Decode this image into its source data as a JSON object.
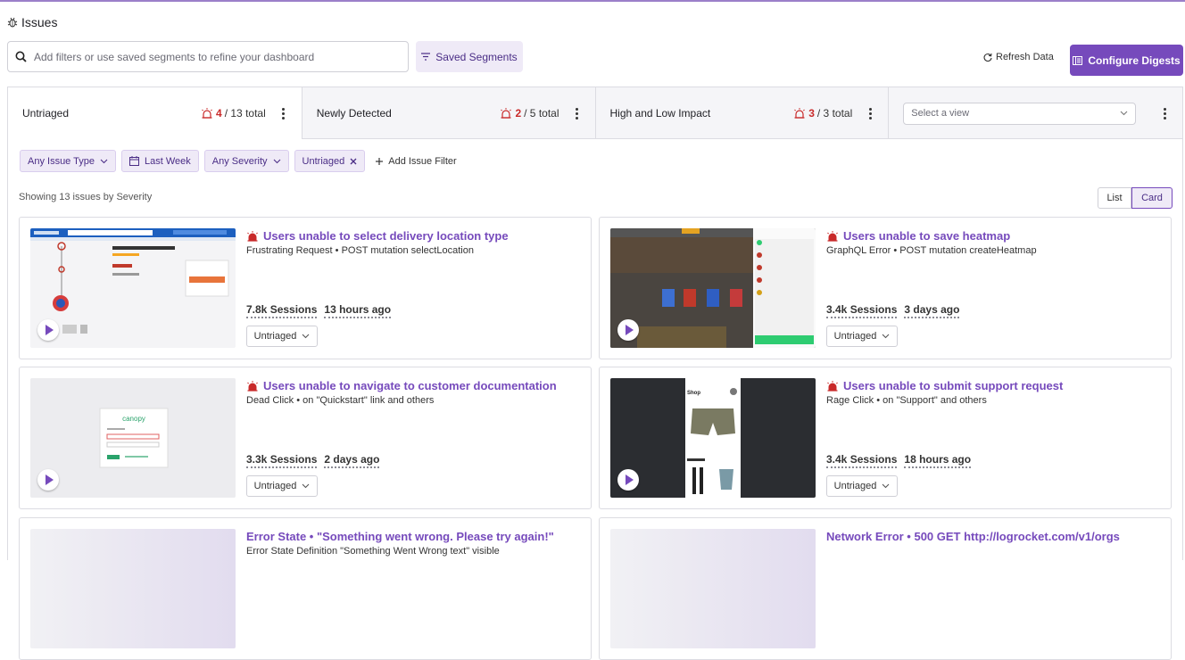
{
  "page": {
    "title": "Issues"
  },
  "search": {
    "placeholder": "Add filters or use saved segments to refine your dashboard"
  },
  "toolbar": {
    "saved_segments": "Saved Segments",
    "refresh": "Refresh Data",
    "configure": "Configure Digests"
  },
  "tabs": [
    {
      "label": "Untriaged",
      "count": "4",
      "total": "/ 13 total"
    },
    {
      "label": "Newly Detected",
      "count": "2",
      "total": "/ 5 total"
    },
    {
      "label": "High and Low Impact",
      "count": "3",
      "total": "/ 3 total"
    }
  ],
  "view_select": {
    "placeholder": "Select a view"
  },
  "filters": {
    "issue_type": "Any Issue Type",
    "date": "Last Week",
    "severity": "Any Severity",
    "status": "Untriaged",
    "add": "Add Issue Filter"
  },
  "summary": "Showing 13 issues by Severity",
  "view_toggle": {
    "list": "List",
    "card": "Card",
    "selected": "Card"
  },
  "cards": [
    {
      "title": "Users unable to select delivery location type",
      "subtitle": "Frustrating Request • POST mutation selectLocation",
      "sessions": "7.8k Sessions",
      "time": "13 hours ago",
      "status": "Untriaged"
    },
    {
      "title": "Users unable to save heatmap",
      "subtitle": "GraphQL Error • POST mutation createHeatmap",
      "sessions": "3.4k Sessions",
      "time": "3 days ago",
      "status": "Untriaged"
    },
    {
      "title": "Users unable to navigate to customer documentation",
      "subtitle": "Dead Click • on \"Quickstart\" link and others",
      "sessions": "3.3k Sessions",
      "time": "2 days ago",
      "status": "Untriaged"
    },
    {
      "title": "Users unable to submit support request",
      "subtitle": "Rage Click • on \"Support\" and others",
      "sessions": "3.4k Sessions",
      "time": "18 hours ago",
      "status": "Untriaged"
    },
    {
      "title": "Error State • \"Something went wrong. Please try again!\"",
      "subtitle": "Error State Definition \"Something Went Wrong text\" visible"
    },
    {
      "title": "Network Error • 500 GET http://logrocket.com/v1/orgs",
      "subtitle": ""
    }
  ],
  "thumbnails": {
    "canopy_logo": "canopy",
    "shop_label": "Shop"
  },
  "colors": {
    "accent": "#764abc",
    "alert": "#c92a2a"
  }
}
